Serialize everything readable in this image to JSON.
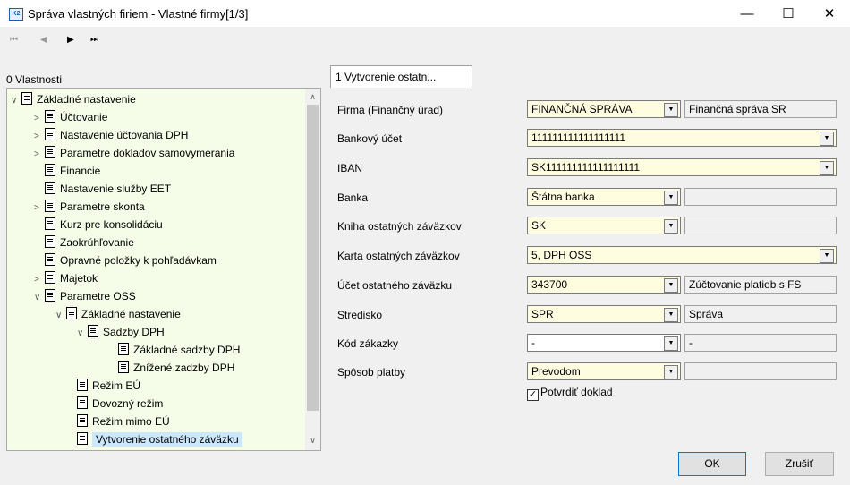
{
  "window": {
    "title": "Správa vlastných firiem - Vlastné firmy[1/3]",
    "icon": "K2"
  },
  "toolbar": {
    "first": "⏮",
    "prev": "◀",
    "next": "▶",
    "last": "⏭"
  },
  "panel_label": "0 Vlastnosti",
  "tree": [
    {
      "label": "Základné nastavenie",
      "expander": "∨"
    },
    {
      "label": "Účtovanie",
      "expander": ">"
    },
    {
      "label": "Nastavenie účtovania DPH",
      "expander": ">"
    },
    {
      "label": "Parametre dokladov samovymerania",
      "expander": ">"
    },
    {
      "label": "Financie",
      "expander": ""
    },
    {
      "label": "Nastavenie služby EET",
      "expander": ""
    },
    {
      "label": "Parametre skonta",
      "expander": ">"
    },
    {
      "label": "Kurz pre konsolidáciu",
      "expander": ""
    },
    {
      "label": "Zaokrúhľovanie",
      "expander": ""
    },
    {
      "label": "Opravné položky k pohľadávkam",
      "expander": ""
    },
    {
      "label": "Majetok",
      "expander": ">"
    },
    {
      "label": "Parametre OSS",
      "expander": "∨"
    },
    {
      "label": "Základné nastavenie",
      "expander": "∨"
    },
    {
      "label": "Sadzby DPH",
      "expander": "∨"
    },
    {
      "label": "Základné sadzby DPH",
      "expander": ""
    },
    {
      "label": "Znížené zadzby DPH",
      "expander": ""
    },
    {
      "label": "Režim EÚ",
      "expander": ""
    },
    {
      "label": "Dovozný režim",
      "expander": ""
    },
    {
      "label": "Režim mimo EÚ",
      "expander": ""
    },
    {
      "label": "Vytvorenie ostatného záväzku",
      "expander": ""
    }
  ],
  "tab": {
    "label": "1 Vytvorenie ostatn..."
  },
  "form": {
    "firma": {
      "label": "Firma (Finančný úrad)",
      "value": "FINANČNÁ SPRÁVA",
      "desc": "Finančná správa SR"
    },
    "ucet": {
      "label": "Bankový účet",
      "value": "111111111111111111"
    },
    "iban": {
      "label": "IBAN",
      "value": "SK111111111111111111"
    },
    "banka": {
      "label": "Banka",
      "value": "Štátna banka",
      "desc": ""
    },
    "kniha": {
      "label": "Kniha ostatných záväzkov",
      "value": "SK",
      "desc": ""
    },
    "karta": {
      "label": "Karta ostatných záväzkov",
      "value": "5, DPH OSS"
    },
    "ucet_z": {
      "label": "Účet ostatného záväzku",
      "value": "343700",
      "desc": "Zúčtovanie platieb s FS"
    },
    "stredisko": {
      "label": "Stredisko",
      "value": "SPR",
      "desc": "Správa"
    },
    "kod": {
      "label": "Kód zákazky",
      "value": "-",
      "desc": "-"
    },
    "platba": {
      "label": "Spôsob platby",
      "value": "Prevodom",
      "desc": ""
    },
    "confirm": {
      "label": "Potvrdiť doklad",
      "checked": "✓"
    }
  },
  "buttons": {
    "ok": "OK",
    "cancel": "Zrušiť"
  },
  "window_controls": {
    "minimize": "—",
    "maximize": "☐",
    "close": "✕"
  }
}
